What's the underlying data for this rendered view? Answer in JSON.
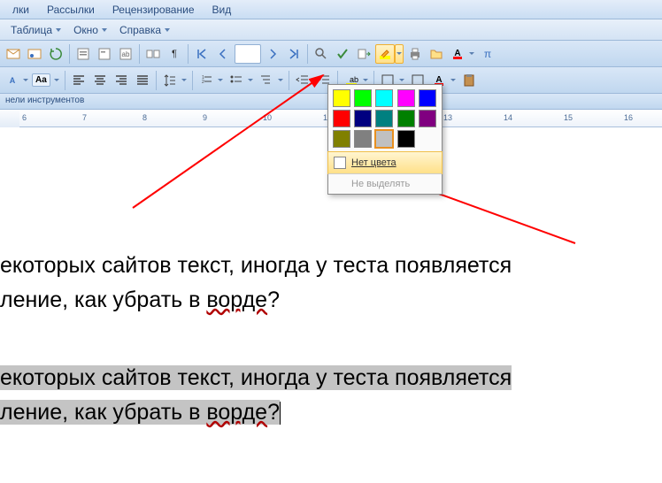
{
  "menus": {
    "mailings": "Рассылки",
    "review": "Рецензирование",
    "view": "Вид",
    "lki": "лки"
  },
  "submenus": {
    "table": "Таблица",
    "window": "Окно",
    "help": "Справка"
  },
  "tooloptions": "нели инструментов",
  "ruler": {
    "start": 6,
    "end": 16
  },
  "colorpop": {
    "colors": [
      "#ffff00",
      "#00ff00",
      "#00ffff",
      "#ff00ff",
      "#0000ff",
      "#ff0000",
      "#000080",
      "#008080",
      "#008000",
      "#800080",
      "#808000",
      "#808080",
      "#c0c0c0",
      "#000000"
    ],
    "nocolor": "Нет цвета",
    "noselect": "Не выделять"
  },
  "doc": {
    "line1a": "екоторых сайтов текст, иногда у теста появляется",
    "line1b": "ление, как убрать в ",
    "line1c": "ворде",
    "line1d": "?"
  }
}
